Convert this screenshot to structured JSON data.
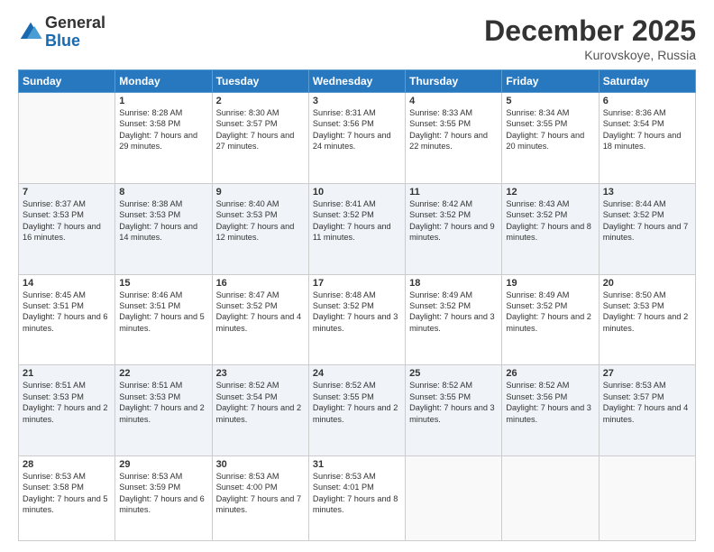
{
  "logo": {
    "general": "General",
    "blue": "Blue"
  },
  "header": {
    "month": "December 2025",
    "location": "Kurovskoye, Russia"
  },
  "weekdays": [
    "Sunday",
    "Monday",
    "Tuesday",
    "Wednesday",
    "Thursday",
    "Friday",
    "Saturday"
  ],
  "weeks": [
    [
      {
        "day": null
      },
      {
        "day": 1,
        "sunrise": "8:28 AM",
        "sunset": "3:58 PM",
        "daylight": "7 hours and 29 minutes."
      },
      {
        "day": 2,
        "sunrise": "8:30 AM",
        "sunset": "3:57 PM",
        "daylight": "7 hours and 27 minutes."
      },
      {
        "day": 3,
        "sunrise": "8:31 AM",
        "sunset": "3:56 PM",
        "daylight": "7 hours and 24 minutes."
      },
      {
        "day": 4,
        "sunrise": "8:33 AM",
        "sunset": "3:55 PM",
        "daylight": "7 hours and 22 minutes."
      },
      {
        "day": 5,
        "sunrise": "8:34 AM",
        "sunset": "3:55 PM",
        "daylight": "7 hours and 20 minutes."
      },
      {
        "day": 6,
        "sunrise": "8:36 AM",
        "sunset": "3:54 PM",
        "daylight": "7 hours and 18 minutes."
      }
    ],
    [
      {
        "day": 7,
        "sunrise": "8:37 AM",
        "sunset": "3:53 PM",
        "daylight": "7 hours and 16 minutes."
      },
      {
        "day": 8,
        "sunrise": "8:38 AM",
        "sunset": "3:53 PM",
        "daylight": "7 hours and 14 minutes."
      },
      {
        "day": 9,
        "sunrise": "8:40 AM",
        "sunset": "3:53 PM",
        "daylight": "7 hours and 12 minutes."
      },
      {
        "day": 10,
        "sunrise": "8:41 AM",
        "sunset": "3:52 PM",
        "daylight": "7 hours and 11 minutes."
      },
      {
        "day": 11,
        "sunrise": "8:42 AM",
        "sunset": "3:52 PM",
        "daylight": "7 hours and 9 minutes."
      },
      {
        "day": 12,
        "sunrise": "8:43 AM",
        "sunset": "3:52 PM",
        "daylight": "7 hours and 8 minutes."
      },
      {
        "day": 13,
        "sunrise": "8:44 AM",
        "sunset": "3:52 PM",
        "daylight": "7 hours and 7 minutes."
      }
    ],
    [
      {
        "day": 14,
        "sunrise": "8:45 AM",
        "sunset": "3:51 PM",
        "daylight": "7 hours and 6 minutes."
      },
      {
        "day": 15,
        "sunrise": "8:46 AM",
        "sunset": "3:51 PM",
        "daylight": "7 hours and 5 minutes."
      },
      {
        "day": 16,
        "sunrise": "8:47 AM",
        "sunset": "3:52 PM",
        "daylight": "7 hours and 4 minutes."
      },
      {
        "day": 17,
        "sunrise": "8:48 AM",
        "sunset": "3:52 PM",
        "daylight": "7 hours and 3 minutes."
      },
      {
        "day": 18,
        "sunrise": "8:49 AM",
        "sunset": "3:52 PM",
        "daylight": "7 hours and 3 minutes."
      },
      {
        "day": 19,
        "sunrise": "8:49 AM",
        "sunset": "3:52 PM",
        "daylight": "7 hours and 2 minutes."
      },
      {
        "day": 20,
        "sunrise": "8:50 AM",
        "sunset": "3:53 PM",
        "daylight": "7 hours and 2 minutes."
      }
    ],
    [
      {
        "day": 21,
        "sunrise": "8:51 AM",
        "sunset": "3:53 PM",
        "daylight": "7 hours and 2 minutes."
      },
      {
        "day": 22,
        "sunrise": "8:51 AM",
        "sunset": "3:53 PM",
        "daylight": "7 hours and 2 minutes."
      },
      {
        "day": 23,
        "sunrise": "8:52 AM",
        "sunset": "3:54 PM",
        "daylight": "7 hours and 2 minutes."
      },
      {
        "day": 24,
        "sunrise": "8:52 AM",
        "sunset": "3:55 PM",
        "daylight": "7 hours and 2 minutes."
      },
      {
        "day": 25,
        "sunrise": "8:52 AM",
        "sunset": "3:55 PM",
        "daylight": "7 hours and 3 minutes."
      },
      {
        "day": 26,
        "sunrise": "8:52 AM",
        "sunset": "3:56 PM",
        "daylight": "7 hours and 3 minutes."
      },
      {
        "day": 27,
        "sunrise": "8:53 AM",
        "sunset": "3:57 PM",
        "daylight": "7 hours and 4 minutes."
      }
    ],
    [
      {
        "day": 28,
        "sunrise": "8:53 AM",
        "sunset": "3:58 PM",
        "daylight": "7 hours and 5 minutes."
      },
      {
        "day": 29,
        "sunrise": "8:53 AM",
        "sunset": "3:59 PM",
        "daylight": "7 hours and 6 minutes."
      },
      {
        "day": 30,
        "sunrise": "8:53 AM",
        "sunset": "4:00 PM",
        "daylight": "7 hours and 7 minutes."
      },
      {
        "day": 31,
        "sunrise": "8:53 AM",
        "sunset": "4:01 PM",
        "daylight": "7 hours and 8 minutes."
      },
      {
        "day": null
      },
      {
        "day": null
      },
      {
        "day": null
      }
    ]
  ]
}
